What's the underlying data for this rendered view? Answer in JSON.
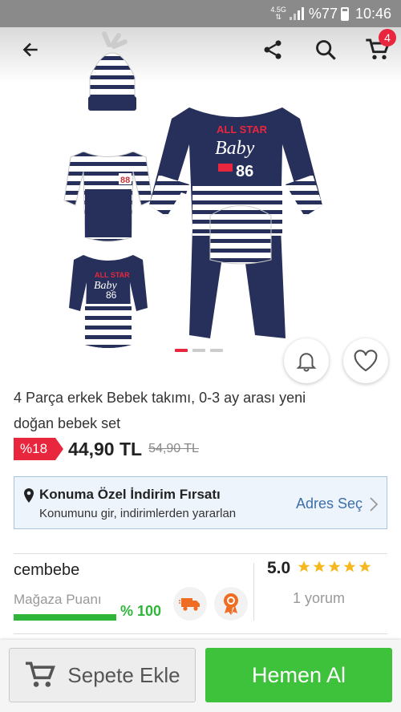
{
  "status_bar": {
    "network": "4.5G",
    "battery_text": "%77",
    "time": "10:46"
  },
  "cart": {
    "badge_count": "4"
  },
  "gallery": {
    "image_count": 3,
    "active_index": 0
  },
  "product": {
    "title": "4 Parça erkek Bebek takımı, 0-3 ay arası yeni doğan bebek set",
    "discount": "%18",
    "price": "44,90 TL",
    "old_price": "54,90 TL"
  },
  "promo": {
    "title": "Konuma Özel İndirim Fırsatı",
    "subtitle": "Konumunu gir, indirimlerden yararlan",
    "link": "Adres Seç"
  },
  "seller": {
    "name": "cembebe",
    "score_label": "Mağaza Puanı",
    "score_percent": "% 100",
    "score_value": 1.0
  },
  "rating": {
    "value": "5.0",
    "stars": 5,
    "reviews": "1 yorum"
  },
  "actions": {
    "add_to_cart": "Sepete Ekle",
    "buy_now": "Hemen Al"
  },
  "colors": {
    "accent_red": "#e8263d",
    "green": "#3ec23b",
    "navy": "#26305a",
    "link_blue": "#3d6fa8"
  }
}
